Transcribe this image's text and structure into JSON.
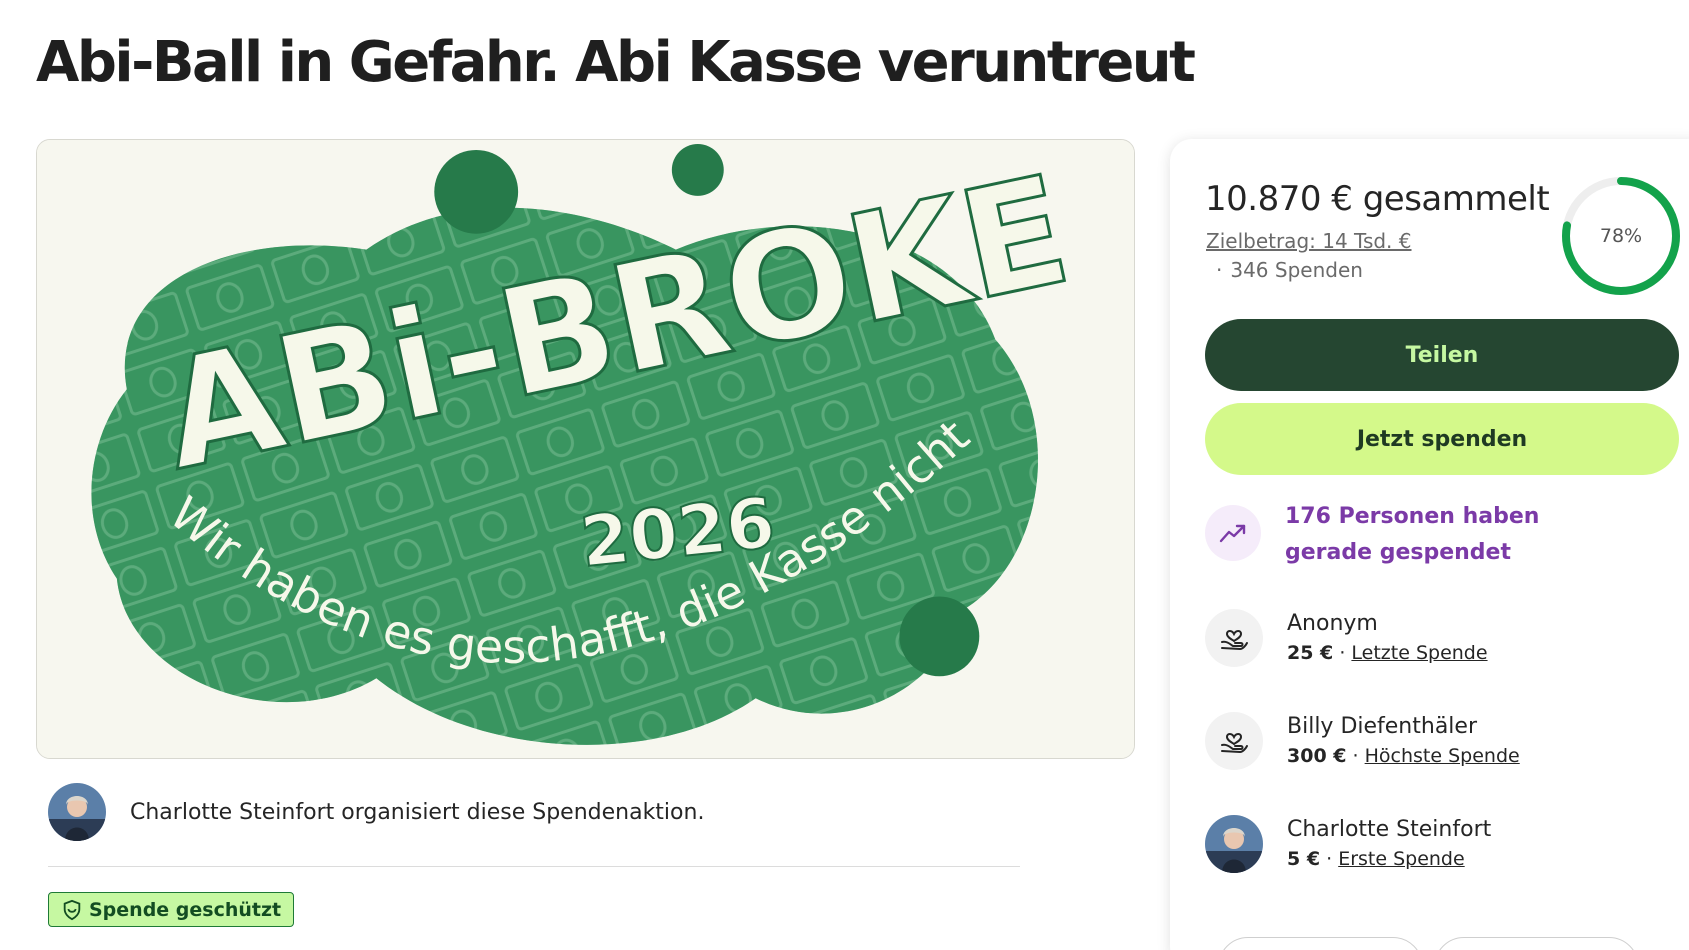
{
  "page": {
    "title": "Abi-Ball in Gefahr. Abi Kasse veruntreut"
  },
  "hero": {
    "headline": "ABi-BROKE",
    "year": "2026",
    "tagline": "Wir haben es geschafft, die Kasse nicht",
    "colors": {
      "blob": "#2e8a56",
      "light_blob": "#7fc29a",
      "dot": "#267a4a",
      "letters": "#f6f8ea"
    }
  },
  "organizer": {
    "text": "Charlotte Steinfort organisiert diese Spendenaktion."
  },
  "badge": {
    "label": "Spende geschützt",
    "icon": "shield-icon"
  },
  "summary": {
    "raised": "10.870 € gesammelt",
    "goal": "Zielbetrag: 14 Tsd. €",
    "donations": "346 Spenden",
    "percent_label": "78%",
    "progress": 0.78
  },
  "actions": {
    "share": "Teilen",
    "donate": "Jetzt spenden"
  },
  "trend": {
    "text": "176 Personen haben gerade gespendet",
    "icon": "trending-up-icon"
  },
  "donors": [
    {
      "name": "Anonym",
      "amount": "25 €",
      "separator": " · ",
      "tag": "Letzte Spende",
      "icon": "heart-hand-icon"
    },
    {
      "name": "Billy Diefenthäler",
      "amount": "300 €",
      "separator": " · ",
      "tag": "Höchste Spende",
      "icon": "heart-hand-icon"
    },
    {
      "name": "Charlotte Steinfort",
      "amount": "5 €",
      "separator": " · ",
      "tag": "Erste Spende",
      "icon": "avatar"
    }
  ],
  "colors": {
    "accent_dark": "#254631",
    "accent_lime": "#d4f98a",
    "progress_green": "#13a24b",
    "trend_purple": "#7b3aa7",
    "badge_bg": "#c6f8a2"
  }
}
